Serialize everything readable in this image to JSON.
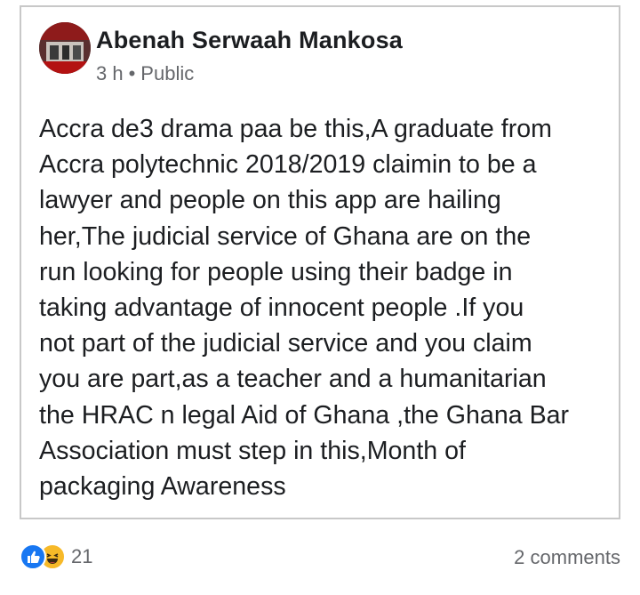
{
  "post": {
    "author": "Abenah Serwaah Mankosa",
    "time": "3 h",
    "separator": "•",
    "audience": "Public",
    "body": "Accra de3 drama paa be this,A graduate from\nAccra polytechnic 2018/2019 claimin to be a\nlawyer and people on this app are hailing\nher,The judicial service of Ghana are on the\nrun looking for people using their badge in\ntaking advantage of innocent people .If you\nnot part of the judicial service and you claim\nyou are part,as a teacher and a humanitarian\nthe HRAC n legal Aid of Ghana ,the Ghana Bar\nAssociation must step in this,Month of\npackaging Awareness"
  },
  "footer": {
    "reaction_count": "21",
    "comments": "2 comments"
  },
  "icons": {
    "like": "like-icon",
    "haha": "haha-icon",
    "avatar": "avatar"
  },
  "colors": {
    "like": "#1877f2",
    "haha": "#f7b928",
    "text": "#1c1e21",
    "muted": "#65676b"
  }
}
